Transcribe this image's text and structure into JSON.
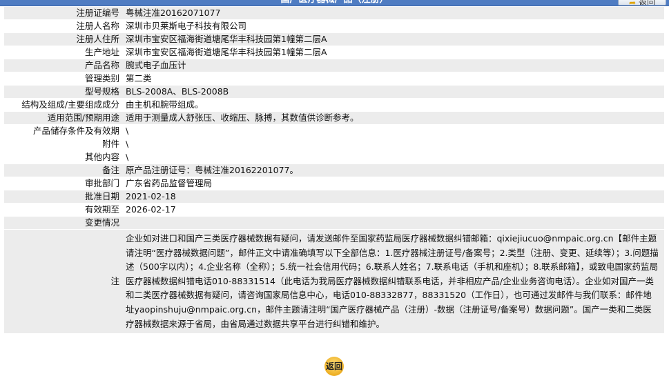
{
  "header": {
    "title": "国产医疗器械产品（注册）",
    "back_label": "返回"
  },
  "fields": [
    {
      "label": "注册证编号",
      "value": "粤械注准20162071077"
    },
    {
      "label": "注册人名称",
      "value": "深圳市贝莱斯电子科技有限公司"
    },
    {
      "label": "注册人住所",
      "value": "深圳市宝安区福海街道塘尾华丰科技园第1幢第二层A"
    },
    {
      "label": "生产地址",
      "value": "深圳市宝安区福海街道塘尾华丰科技园第1幢第二层A"
    },
    {
      "label": "产品名称",
      "value": "腕式电子血压计"
    },
    {
      "label": "管理类别",
      "value": "第二类"
    },
    {
      "label": "型号规格",
      "value": "BLS-2008A、BLS-2008B"
    },
    {
      "label": "结构及组成/主要组成成分",
      "value": "由主机和腕带组成。"
    },
    {
      "label": "适用范围/预期用途",
      "value": "适用于测量成人舒张压、收缩压、脉搏，其数值供诊断参考。"
    },
    {
      "label": "产品储存条件及有效期",
      "value": "\\"
    },
    {
      "label": "附件",
      "value": "\\"
    },
    {
      "label": "其他内容",
      "value": "\\"
    },
    {
      "label": "备注",
      "value": "原产品注册证号：粤械注准20162201077。"
    },
    {
      "label": "审批部门",
      "value": "广东省药品监督管理局"
    },
    {
      "label": "批准日期",
      "value": "2021-02-18"
    },
    {
      "label": "有效期至",
      "value": "2026-02-17"
    },
    {
      "label": "变更情况",
      "value": ""
    }
  ],
  "note": {
    "label": "注",
    "text": "企业如对进口和国产三类医疗器械数据有疑问，请发送邮件至国家药监局医疗器械数据纠错邮箱：qixiejiucuo@nmpaic.org.cn【邮件主题请注明“医疗器械数据问题”，邮件正文中请准确填写以下全部信息：1.医疗器械注册证号/备案号；2.类型（注册、变更、延续等）；3.问题描述（500字以内）；4.企业名称（全称）；5.统一社会信用代码；6.联系人姓名；7.联系电话（手机和座机）；8.联系邮箱】，或致电国家药监局医疗器械数据纠错电话010-88331514（此电话为我局医疗器械数据纠错联系电话，并非相应产品/企业业务咨询电话）。企业如对国产一类和二类医疗器械数据有疑问，请咨询国家局信息中心，电话010-88332877，88331520（工作日），也可通过发邮件与我们联系：邮件地址yaopinshuju@nmpaic.org.cn，邮件主题请注明“国产医疗器械产品（注册）-数据（注册证号/备案号）数据问题”。国产一类和二类医疗器械数据来源于省局，由省局通过数据共享平台进行纠错和维护。"
  },
  "footer": {
    "back_label": "返回"
  }
}
